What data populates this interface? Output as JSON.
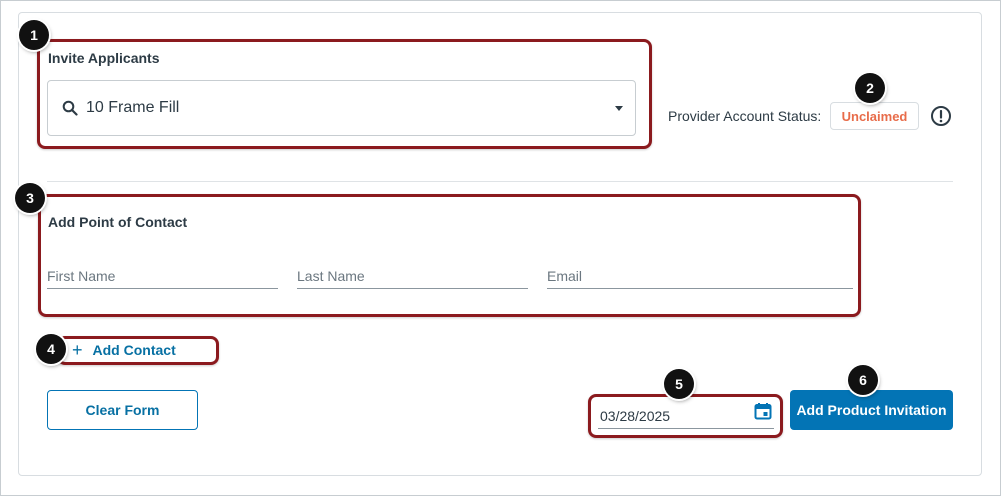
{
  "invite_section": {
    "label": "Invite Applicants",
    "search_icon": "search-icon",
    "selected_value": "10 Frame Fill",
    "dropdown_icon": "caret-down-icon"
  },
  "provider_status": {
    "label": "Provider Account Status:",
    "badge": "Unclaimed",
    "badge_color": "#e86c4a",
    "info_icon": "exclamation-circle-icon"
  },
  "contact_section": {
    "label": "Add Point of Contact",
    "first_name_placeholder": "First Name",
    "last_name_placeholder": "Last Name",
    "email_placeholder": "Email"
  },
  "actions": {
    "add_contact_label": "Add Contact",
    "add_contact_icon": "plus-icon",
    "clear_form_label": "Clear Form",
    "date_value": "03/28/2025",
    "calendar_icon": "calendar-icon",
    "add_invitation_label": "Add Product Invitation"
  },
  "callouts": [
    "1",
    "2",
    "3",
    "4",
    "5",
    "6"
  ],
  "colors": {
    "primary": "#0374b5",
    "link": "#0770a3",
    "callout_border": "#8b1a1e",
    "text": "#2d3b45"
  }
}
